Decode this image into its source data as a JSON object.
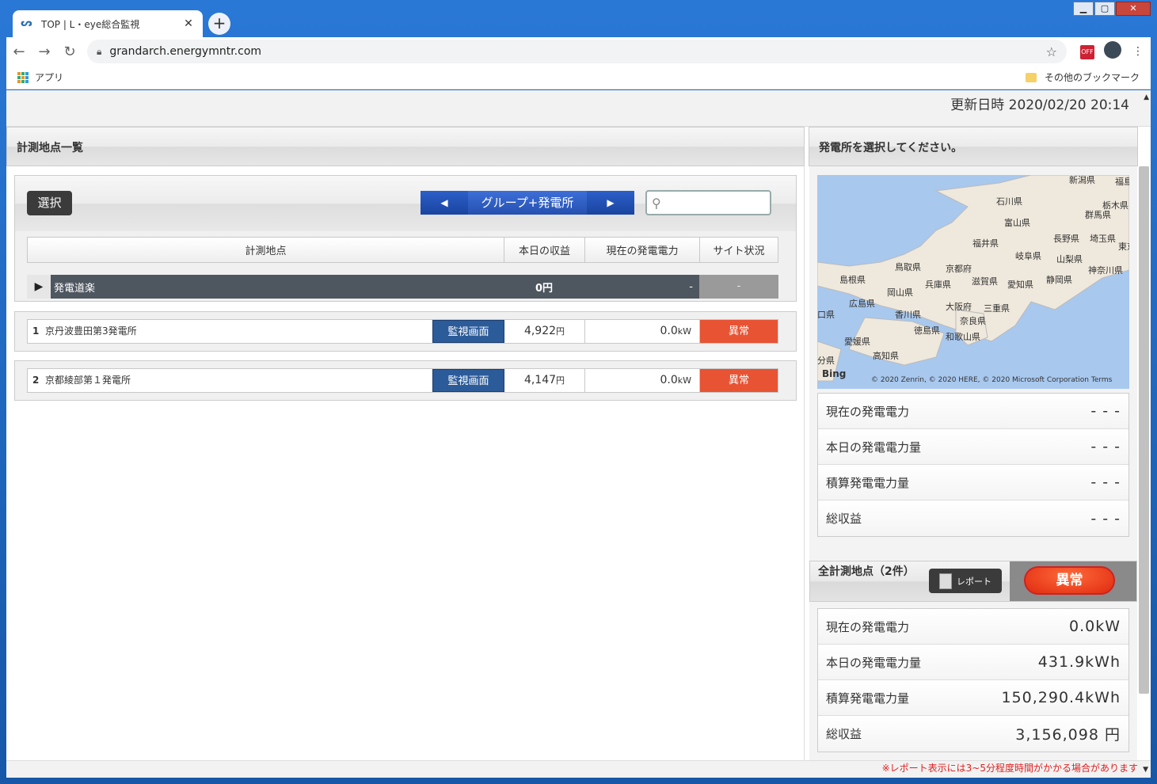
{
  "browser": {
    "tab_title": "TOP | L・eye総合監視",
    "url": "grandarch.energymntr.com",
    "bookmarks_apps": "アプリ",
    "bookmarks_other": "その他のブックマーク",
    "ext_label": "OFF"
  },
  "header": {
    "updated": "更新日時 2020/02/20 20:14"
  },
  "left": {
    "title": "計測地点一覧",
    "select_label": "選択",
    "group_label": "グループ+発電所",
    "columns": [
      "計測地点",
      "本日の収益",
      "現在の発電電力",
      "サイト状況"
    ],
    "group": {
      "name": "発電道楽",
      "income": "0円",
      "power": "-",
      "status": "-"
    },
    "sites": [
      {
        "num": "1",
        "name": "京丹波豊田第3発電所",
        "monitor": "監視画面",
        "income": "4,922",
        "income_unit": "円",
        "power": "0.0",
        "power_unit": "kW",
        "status": "異常"
      },
      {
        "num": "2",
        "name": "京都綾部第１発電所",
        "monitor": "監視画面",
        "income": "4,147",
        "income_unit": "円",
        "power": "0.0",
        "power_unit": "kW",
        "status": "異常"
      }
    ]
  },
  "right": {
    "title": "発電所を選択してください。",
    "map": {
      "copyright": "© 2020 Zenrin, © 2020 HERE, © 2020 Microsoft Corporation  Terms",
      "bing": "Bing",
      "labels": [
        "石川県",
        "富山県",
        "福井県",
        "岐阜県",
        "長野県",
        "群馬県",
        "栃木県",
        "埼玉県",
        "山梨県",
        "神奈川県",
        "静岡県",
        "愛知県",
        "滋賀県",
        "京都府",
        "鳥取県",
        "島根県",
        "岡山県",
        "兵庫県",
        "大阪府",
        "三重県",
        "奈良県",
        "和歌山県",
        "広島県",
        "香川県",
        "徳島県",
        "愛媛県",
        "高知県",
        "分県",
        "福島",
        "新潟県",
        "東京",
        "口県"
      ]
    },
    "selected_stats": [
      {
        "label": "現在の発電電力",
        "value": "- - -"
      },
      {
        "label": "本日の発電電力量",
        "value": "- - -"
      },
      {
        "label": "積算発電電力量",
        "value": "- - -"
      },
      {
        "label": "総収益",
        "value": "- - -"
      }
    ],
    "all_title": "全計測地点（2件）",
    "report_label": "レポート",
    "all_status": "異常",
    "all_stats": [
      {
        "label": "現在の発電電力",
        "value": "0.0kW"
      },
      {
        "label": "本日の発電電力量",
        "value": "431.9kWh"
      },
      {
        "label": "積算発電電力量",
        "value": "150,290.4kWh"
      },
      {
        "label": "総収益",
        "value": "3,156,098 円"
      }
    ],
    "footnote": "※レポート表示には3~5分程度時間がかかる場合があります"
  }
}
